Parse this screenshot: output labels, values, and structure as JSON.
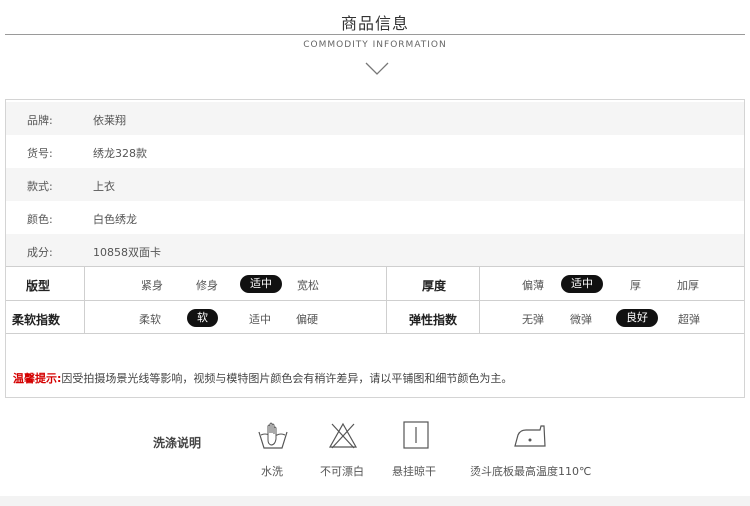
{
  "header": {
    "title": "商品信息",
    "subtitle": "COMMODITY INFORMATION"
  },
  "info_rows": [
    {
      "label": "品牌:",
      "value": "依莱翔"
    },
    {
      "label": "货号:",
      "value": "绣龙328款"
    },
    {
      "label": "款式:",
      "value": "上衣"
    },
    {
      "label": "颜色:",
      "value": "白色绣龙"
    },
    {
      "label": "成分:",
      "value": "10858双面卡"
    }
  ],
  "ratings": {
    "fit": {
      "label": "版型",
      "options": [
        "紧身",
        "修身",
        "适中",
        "宽松"
      ],
      "selected": "适中"
    },
    "thickness": {
      "label": "厚度",
      "options": [
        "偏薄",
        "适中",
        "厚",
        "加厚"
      ],
      "selected": "适中"
    },
    "softness": {
      "label": "柔软指数",
      "options": [
        "柔软",
        "软",
        "适中",
        "偏硬"
      ],
      "selected": "软"
    },
    "elasticity": {
      "label": "弹性指数",
      "options": [
        "无弹",
        "微弹",
        "良好",
        "超弹"
      ],
      "selected": "良好"
    }
  },
  "notice": {
    "prefix": "温馨提示:",
    "text": "因受拍摄场景光线等影响，视频与模特图片颜色会有稍许差异，请以平铺图和细节颜色为主。"
  },
  "care": {
    "label": "洗涤说明",
    "items": [
      {
        "icon": "hand-wash-icon",
        "caption": "水洗"
      },
      {
        "icon": "no-bleach-icon",
        "caption": "不可漂白"
      },
      {
        "icon": "hang-dry-icon",
        "caption": "悬挂晾干"
      },
      {
        "icon": "iron-icon",
        "caption": "烫斗底板最高温度110℃"
      }
    ]
  }
}
